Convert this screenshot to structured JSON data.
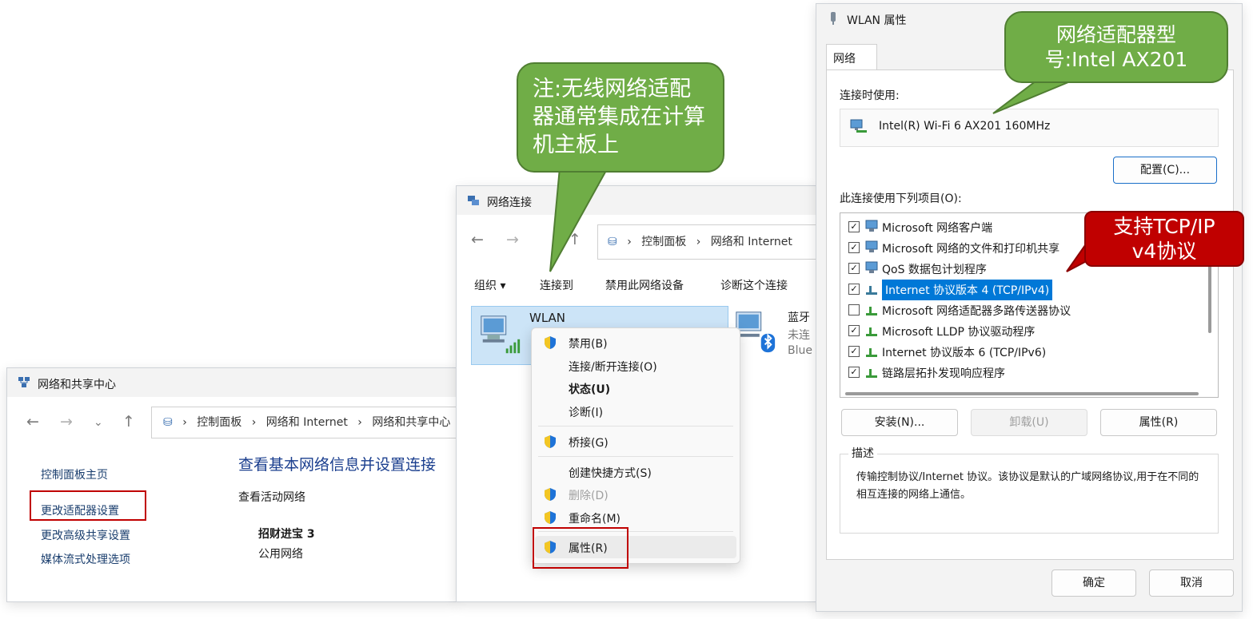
{
  "sharing_center": {
    "title": "网络和共享中心",
    "breadcrumb": [
      "控制面板",
      "网络和 Internet",
      "网络和共享中心"
    ],
    "sidebar": [
      "控制面板主页",
      "更改适配器设置",
      "更改高级共享设置",
      "媒体流式处理选项"
    ],
    "main_heading": "查看基本网络信息并设置连接",
    "active_label": "查看活动网络",
    "network_name": "招财进宝 3",
    "network_type": "公用网络"
  },
  "net_connections": {
    "title": "网络连接",
    "breadcrumb": [
      "控制面板",
      "网络和 Internet"
    ],
    "toolbar": [
      "组织 ▾",
      "连接到",
      "禁用此网络设备",
      "诊断这个连接"
    ],
    "wlan_name": "WLAN",
    "bt_name": "蓝牙",
    "bt_line2": "未连",
    "bt_line3": "Blue"
  },
  "context_menu": {
    "items": [
      "禁用(B)",
      "连接/断开连接(O)",
      "状态(U)",
      "诊断(I)",
      "桥接(G)",
      "创建快捷方式(S)",
      "删除(D)",
      "重命名(M)",
      "属性(R)"
    ]
  },
  "wlan_props": {
    "title": "WLAN 属性",
    "tab": "网络",
    "connect_using_label": "连接时使用:",
    "adapter_name": "Intel(R) Wi-Fi 6 AX201 160MHz",
    "configure_button": "配置(C)...",
    "items_label": "此连接使用下列项目(O):",
    "items": [
      {
        "label": "Microsoft 网络客户端",
        "checked": true
      },
      {
        "label": "Microsoft 网络的文件和打印机共享",
        "checked": true
      },
      {
        "label": "QoS 数据包计划程序",
        "checked": true
      },
      {
        "label": "Internet 协议版本 4 (TCP/IPv4)",
        "checked": true
      },
      {
        "label": "Microsoft 网络适配器多路传送器协议",
        "checked": false
      },
      {
        "label": "Microsoft LLDP 协议驱动程序",
        "checked": true
      },
      {
        "label": "Internet 协议版本 6 (TCP/IPv6)",
        "checked": true
      },
      {
        "label": "链路层拓扑发现响应程序",
        "checked": true
      }
    ],
    "install_button": "安装(N)...",
    "uninstall_button": "卸载(U)",
    "properties_button": "属性(R)",
    "description_label": "描述",
    "description_text": "传输控制协议/Internet 协议。该协议是默认的广域网络协议,用于在不同的相互连接的网络上通信。",
    "ok_button": "确定",
    "cancel_button": "取消"
  },
  "callouts": {
    "note": "注:无线网络适配器通常集成在计算机主板上",
    "adapter_model": "网络适配器型号:Intel AX201",
    "tcpip": "支持TCP/IP v4协议"
  },
  "colors": {
    "callout_green": "#70ad47",
    "callout_red": "#c00000",
    "highlight_box": "#c00000",
    "selection_blue": "#0078d7"
  }
}
